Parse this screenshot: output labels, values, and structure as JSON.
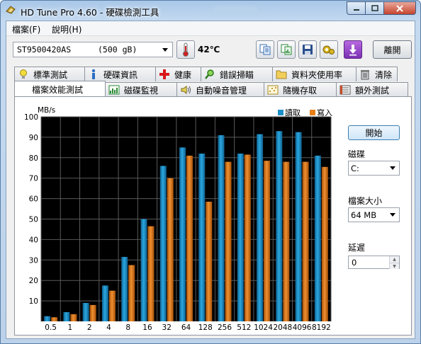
{
  "window": {
    "title": "HD Tune Pro 4.60 - 硬碟檢測工具"
  },
  "menu": [
    {
      "label": "檔案(F)"
    },
    {
      "label": "說明(H)"
    }
  ],
  "toolbar": {
    "drive_model": "ST9500420AS",
    "drive_size": "(500 gB)",
    "temperature": "42℃",
    "exit_label": "離開"
  },
  "tabs_top": [
    {
      "label": "標準測試",
      "icon": "bulb-icon"
    },
    {
      "label": "硬碟資訊",
      "icon": "info-icon"
    },
    {
      "label": "健康",
      "icon": "health-cross-icon"
    },
    {
      "label": "錯誤掃瞄",
      "icon": "magnifier-icon"
    },
    {
      "label": "資料夾使用率",
      "icon": "folder-icon"
    },
    {
      "label": "清除",
      "icon": "trash-icon"
    }
  ],
  "tabs_bottom": [
    {
      "label": "檔案效能測試",
      "icon": "",
      "active": true
    },
    {
      "label": "磁碟監視",
      "icon": "chart-icon"
    },
    {
      "label": "自動噪音管理",
      "icon": "speaker-icon"
    },
    {
      "label": "隨機存取",
      "icon": "scatter-icon"
    },
    {
      "label": "額外測試",
      "icon": "list-icon"
    }
  ],
  "side": {
    "start_label": "開始",
    "disk_label": "磁碟",
    "disk_value": "C:",
    "filesize_label": "檔案大小",
    "filesize_value": "64 MB",
    "delay_label": "延遲",
    "delay_value": "0"
  },
  "chart_data": {
    "type": "bar",
    "ylabel": "MB/s",
    "ylim": [
      0,
      100
    ],
    "yticks": [
      10,
      20,
      30,
      40,
      50,
      60,
      70,
      80,
      90,
      100
    ],
    "grid": true,
    "legend_position": "top-right",
    "categories": [
      "0.5",
      "1",
      "2",
      "4",
      "8",
      "16",
      "32",
      "64",
      "128",
      "256",
      "512",
      "1024",
      "2048",
      "4096",
      "8192"
    ],
    "series": [
      {
        "name": "讀取",
        "color": "#1e90c8",
        "values": [
          2.5,
          4.5,
          9,
          17.5,
          31.5,
          50,
          76,
          85,
          82,
          91,
          82,
          91.5,
          93,
          92.5,
          81
        ]
      },
      {
        "name": "寫入",
        "color": "#e8801a",
        "values": [
          2,
          3.5,
          8,
          15,
          27.5,
          46.5,
          70,
          81,
          58.5,
          78,
          81.5,
          78.5,
          78,
          78,
          75.5
        ]
      }
    ]
  }
}
